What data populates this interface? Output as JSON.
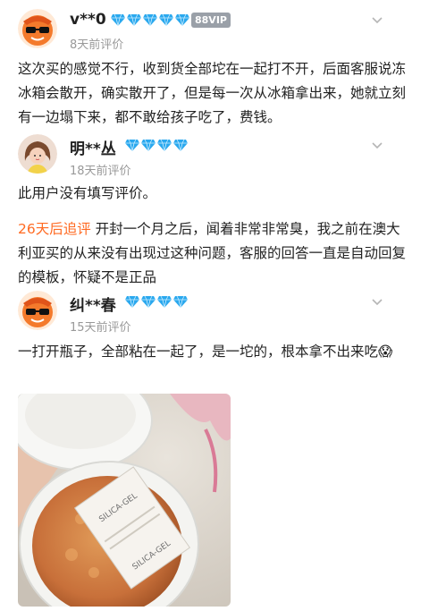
{
  "reviews": [
    {
      "username": "v**0",
      "vip_label": "88VIP",
      "time": "8天前评价",
      "gem_count": 5,
      "content": "这次买的感觉不行，收到货全部坨在一起打不开，后面客服说冻冰箱会散开，确实散开了，但是每一次从冰箱拿出来，她就立刻有一边塌下来，都不敢给孩子吃了，费钱。",
      "avatar_icon": "orange-cartoon-avatar-icon"
    },
    {
      "username": "明**丛",
      "time": "18天前评价",
      "gem_count": 4,
      "content": "此用户没有填写评价。",
      "followup_tag": "26天后追评",
      "followup_text": "开封一个月之后，闻着非常非常臭，我之前在澳大利亚买的从来没有出现过这种问题，客服的回答一直是自动回复的模板，怀疑不是正品",
      "avatar_icon": "girl-avatar-icon"
    },
    {
      "username": "纠**春",
      "time": "15天前评价",
      "gem_count": 4,
      "content": "一打开瓶子，全部粘在一起了，是一坨的，根本拿不出来吃",
      "emoji": "😱",
      "avatar_icon": "orange-cartoon-avatar-icon",
      "photo_icon": "open-jar-photo",
      "photo_text": "SILICA-GEL"
    }
  ],
  "colors": {
    "gem": "#2aa8ee",
    "followup": "#ff6a22",
    "meta": "#999999"
  }
}
